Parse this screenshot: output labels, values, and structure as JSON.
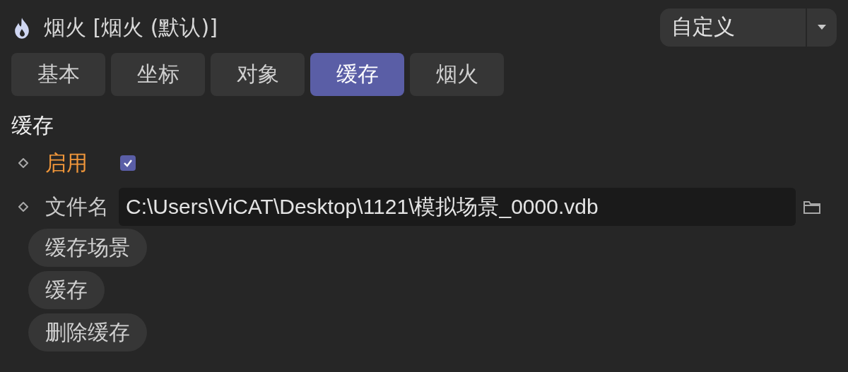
{
  "header": {
    "title": "烟火 [烟火 (默认)]",
    "mode_dropdown": {
      "value": "自定义"
    }
  },
  "tabs": [
    {
      "label": "基本",
      "selected": false
    },
    {
      "label": "坐标",
      "selected": false
    },
    {
      "label": "对象",
      "selected": false
    },
    {
      "label": "缓存",
      "selected": true
    },
    {
      "label": "烟火",
      "selected": false
    }
  ],
  "section": {
    "title": "缓存",
    "params": [
      {
        "kind": "checkbox",
        "label": "启用",
        "modified": true,
        "checked": true
      },
      {
        "kind": "file",
        "label": "文件名",
        "modified": false,
        "value": "C:\\Users\\ViCAT\\Desktop\\1121\\模拟场景_0000.vdb"
      }
    ],
    "buttons": [
      "缓存场景",
      "缓存",
      "删除缓存"
    ]
  }
}
